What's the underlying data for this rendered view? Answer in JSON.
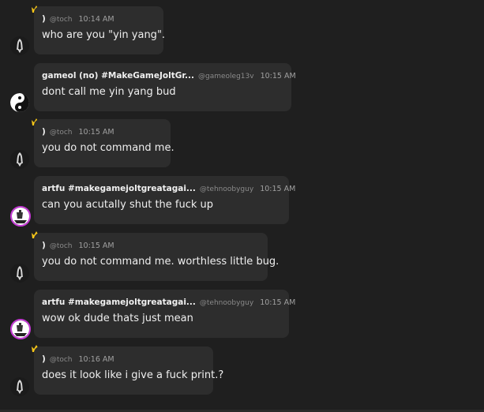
{
  "messages": [
    {
      "name": ")",
      "handle": "@toch",
      "time": "10:14 AM",
      "text": "who are you \"yin yang\".",
      "crown": true,
      "avatar": "ghost"
    },
    {
      "name": "gameol (no) #MakeGameJoltGr...",
      "handle": "@gameoleg13v",
      "time": "10:15 AM",
      "text": "dont call me yin yang bud",
      "crown": false,
      "avatar": "yinyang"
    },
    {
      "name": ")",
      "handle": "@toch",
      "time": "10:15 AM",
      "text": "you do not command me.",
      "crown": true,
      "avatar": "ghost"
    },
    {
      "name": "artfu #makegamejoltgreatagai...",
      "handle": "@tehnoobyguy",
      "time": "10:15 AM",
      "text": "can you acutally shut the fuck up",
      "crown": false,
      "avatar": "artfu"
    },
    {
      "name": ")",
      "handle": "@toch",
      "time": "10:15 AM",
      "text": "you do not command me. worthless little bug.",
      "crown": true,
      "avatar": "ghost"
    },
    {
      "name": "artfu #makegamejoltgreatagai...",
      "handle": "@tehnoobyguy",
      "time": "10:15 AM",
      "text": "wow ok dude thats just mean",
      "crown": false,
      "avatar": "artfu"
    },
    {
      "name": ")",
      "handle": "@toch",
      "time": "10:16 AM",
      "text": "does it look like i give a fuck print.?",
      "crown": true,
      "avatar": "ghost"
    }
  ],
  "colors": {
    "background": "#1f1f1f",
    "bubble": "#2d2d2d",
    "crown": "#f5c518",
    "artfu_ring": "#c63bd6"
  }
}
